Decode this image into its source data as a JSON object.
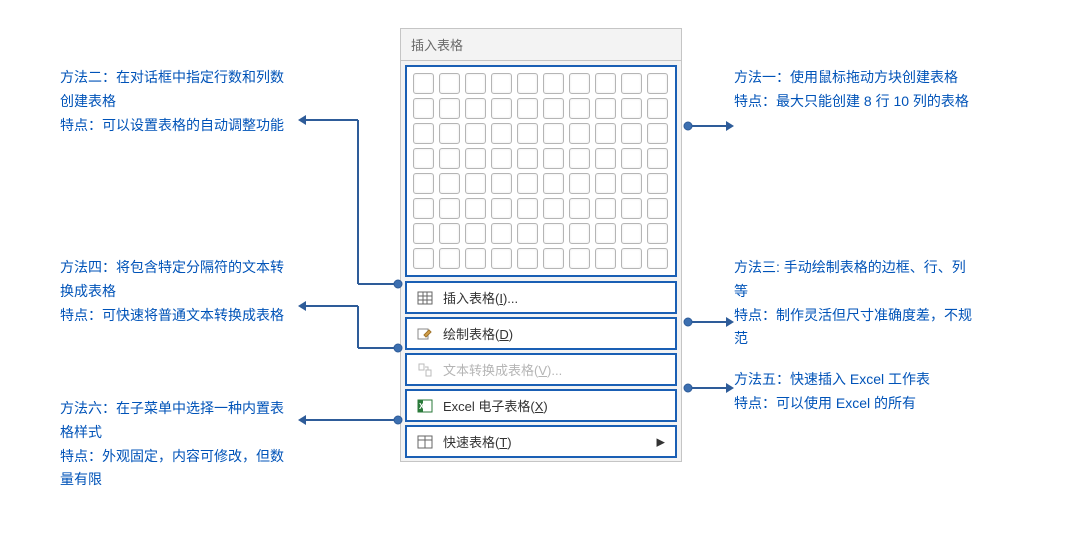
{
  "panel": {
    "title": "插入表格",
    "grid": {
      "rows": 8,
      "cols": 10
    },
    "items": {
      "insert": {
        "label_pre": "插入表格(",
        "accel": "I",
        "label_post": ")..."
      },
      "draw": {
        "label_pre": "绘制表格(",
        "accel": "D",
        "label_post": ")"
      },
      "convert": {
        "label_pre": "文本转换成表格(",
        "accel": "V",
        "label_post": ")..."
      },
      "excel": {
        "label_pre": "Excel 电子表格(",
        "accel": "X",
        "label_post": ")"
      },
      "quick": {
        "label_pre": "快速表格(",
        "accel": "T",
        "label_post": ")"
      }
    }
  },
  "annotations": {
    "a1": {
      "title": "方法一：使用鼠标拖动方块创建表格",
      "note": "特点：最大只能创建 8 行 10 列的表格",
      "underline_word": "建表格"
    },
    "a2": {
      "title": "方法二：在对话框中指定行数和列数创建表格",
      "note": "特点：可以设置表格的自动调整功能"
    },
    "a3": {
      "title": "方法三: 手动绘制表格的边框、行、列等",
      "note": "特点：制作灵活但尺寸准确度差，不规范"
    },
    "a4": {
      "title": "方法四：将包含特定分隔符的文本转换成表格",
      "note": "特点：可快速将普通文本转换成表格"
    },
    "a5": {
      "title": "方法五：快速插入 Excel 工作表",
      "note": "特点：可以使用 Excel 的所有"
    },
    "a6": {
      "title": "方法六：在子菜单中选择一种内置表格样式",
      "note": "特点：外观固定，内容可修改，但数量有限"
    }
  }
}
